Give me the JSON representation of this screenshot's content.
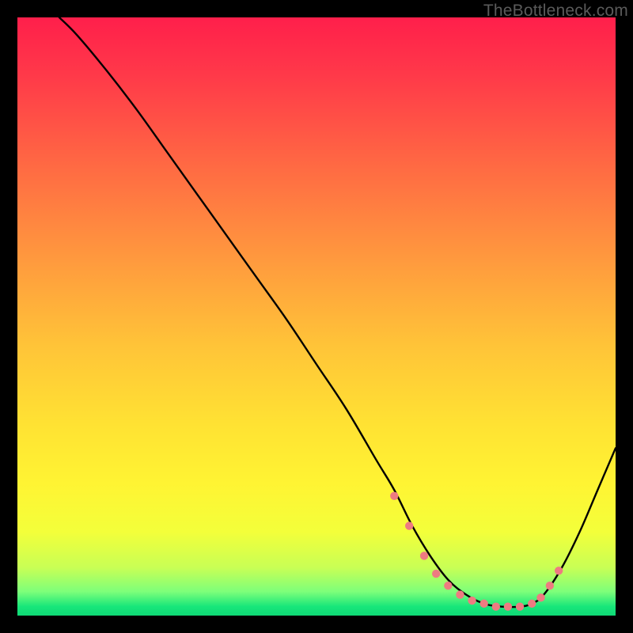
{
  "watermark": "TheBottleneck.com",
  "gradient_stops": [
    {
      "offset": 0.0,
      "color": "#ff1f4b"
    },
    {
      "offset": 0.1,
      "color": "#ff3a49"
    },
    {
      "offset": 0.25,
      "color": "#ff6a43"
    },
    {
      "offset": 0.4,
      "color": "#ff983e"
    },
    {
      "offset": 0.55,
      "color": "#ffc438"
    },
    {
      "offset": 0.68,
      "color": "#ffe233"
    },
    {
      "offset": 0.78,
      "color": "#fff433"
    },
    {
      "offset": 0.86,
      "color": "#f3ff3a"
    },
    {
      "offset": 0.92,
      "color": "#c8ff55"
    },
    {
      "offset": 0.96,
      "color": "#7dff7a"
    },
    {
      "offset": 0.985,
      "color": "#17e67a"
    },
    {
      "offset": 1.0,
      "color": "#0fd976"
    }
  ],
  "marker_color": "#ee7b81",
  "curve_color": "#000000",
  "chart_data": {
    "type": "line",
    "title": "",
    "xlabel": "",
    "ylabel": "",
    "xlim": [
      0,
      100
    ],
    "ylim": [
      0,
      100
    ],
    "series": [
      {
        "name": "bottleneck-curve",
        "x": [
          7,
          10,
          15,
          20,
          25,
          30,
          35,
          40,
          45,
          50,
          55,
          60,
          63,
          66,
          69,
          72,
          75,
          78,
          81,
          84,
          86,
          88,
          91,
          94,
          97,
          100
        ],
        "y": [
          100,
          97,
          91,
          84.5,
          77.5,
          70.5,
          63.5,
          56.5,
          49.5,
          42,
          34.5,
          26,
          21,
          15,
          10,
          6,
          3.5,
          2,
          1.5,
          1.5,
          2,
          3.5,
          8,
          14,
          21,
          28
        ]
      }
    ],
    "markers": {
      "name": "highlight-dots",
      "x": [
        63,
        65.5,
        68,
        70,
        72,
        74,
        76,
        78,
        80,
        82,
        84,
        86,
        87.5,
        89,
        90.5
      ],
      "y": [
        20,
        15,
        10,
        7,
        5,
        3.5,
        2.5,
        2,
        1.5,
        1.5,
        1.5,
        2,
        3,
        5,
        7.5
      ]
    }
  }
}
